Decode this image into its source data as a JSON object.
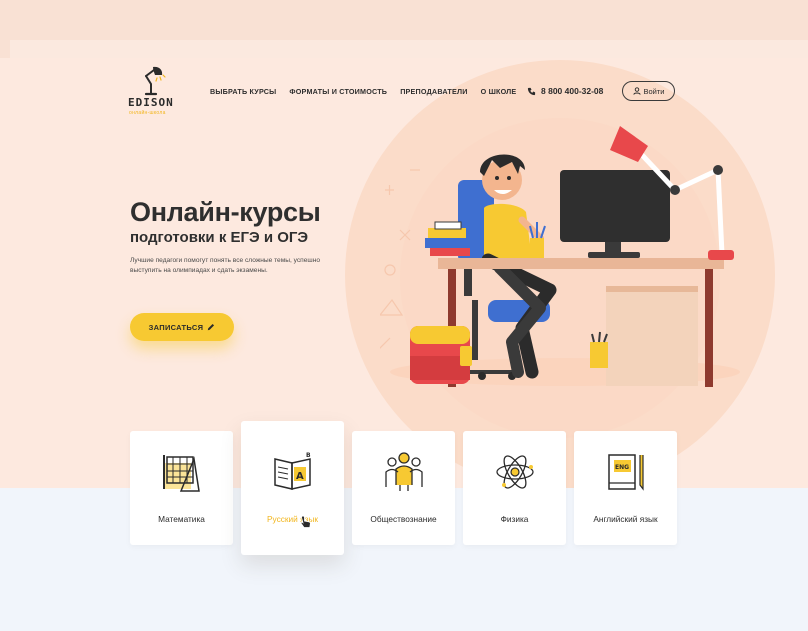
{
  "brand": {
    "name": "EDISON",
    "tagline": "онлайн-школа"
  },
  "nav": {
    "items": [
      {
        "label": "ВЫБРАТЬ КУРСЫ"
      },
      {
        "label": "ФОРМАТЫ И СТОИМОСТЬ"
      },
      {
        "label": "ПРЕПОДАВАТЕЛИ"
      },
      {
        "label": "О ШКОЛЕ"
      }
    ]
  },
  "header": {
    "phone": "8 800 400-32-08",
    "login_label": "Войти"
  },
  "hero": {
    "title": "Онлайн-курсы",
    "subtitle": "подготовки к ЕГЭ и ОГЭ",
    "description": "Лучшие педагоги помогут понять все сложные темы, успешно выступить на олимпиадах и сдать экзамены.",
    "cta_label": "ЗАПИСАТЬСЯ"
  },
  "subjects": [
    {
      "label": "Математика",
      "icon": "math-icon",
      "active": false
    },
    {
      "label": "Русский язык",
      "icon": "book-icon",
      "active": true
    },
    {
      "label": "Обществознание",
      "icon": "people-icon",
      "active": false
    },
    {
      "label": "Физика",
      "icon": "atom-icon",
      "active": false
    },
    {
      "label": "Английский язык",
      "icon": "eng-dictionary-icon",
      "active": false
    }
  ],
  "colors": {
    "accent": "#f7c932",
    "accent_text": "#f2b61e",
    "hero_bg": "#fde9df",
    "lower_bg": "#f1f5fb",
    "text": "#2b2b2b"
  }
}
